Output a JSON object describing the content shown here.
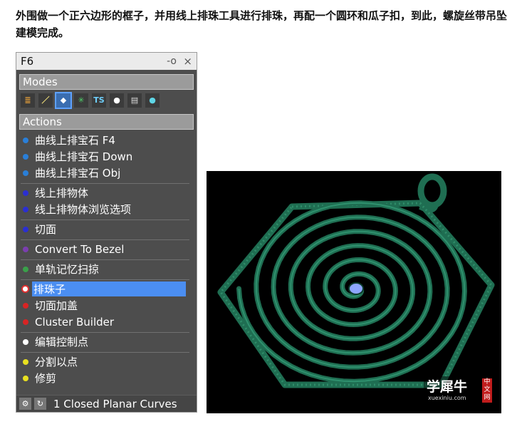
{
  "intro_text": "外围做一个正六边形的框子，并用线上排珠工具进行排珠，再配一个圆环和瓜子扣，到此，螺旋丝带吊坠建模完成。",
  "panel": {
    "title": "F6",
    "pin_icon": "pin-icon",
    "close_glyph": "×",
    "modes_heading": "Modes",
    "mode_icons": [
      {
        "name": "list-icon",
        "glyph": "≣",
        "color": "#e8a23a"
      },
      {
        "name": "curve-icon",
        "glyph": "／",
        "color": "#f5e37a"
      },
      {
        "name": "gem-icon",
        "glyph": "◆",
        "color": "#ffffff"
      },
      {
        "name": "lattice-icon",
        "glyph": "✳",
        "color": "#4fd06b"
      },
      {
        "name": "ts-icon",
        "glyph": "TS",
        "color": "#6fd1ff"
      },
      {
        "name": "user-icon",
        "glyph": "●",
        "color": "#ffffff"
      },
      {
        "name": "document-icon",
        "glyph": "▤",
        "color": "#dddddd"
      },
      {
        "name": "sphere-icon",
        "glyph": "●",
        "color": "#5fd6e6"
      }
    ],
    "actions_heading": "Actions",
    "groups": [
      [
        {
          "label": "曲线上排宝石 F4",
          "dot": "#2a7fd8"
        },
        {
          "label": "曲线上排宝石 Down",
          "dot": "#2a7fd8"
        },
        {
          "label": "曲线上排宝石 Obj",
          "dot": "#2a7fd8"
        }
      ],
      [
        {
          "label": "线上排物体",
          "dot": "#2b2fd1"
        },
        {
          "label": "线上排物体浏览选项",
          "dot": "#2b2fd1"
        }
      ],
      [
        {
          "label": "切面",
          "dot": "#2b2fd1"
        }
      ],
      [
        {
          "label": "Convert To Bezel",
          "dot": "#7a3fb0"
        }
      ],
      [
        {
          "label": "单轨记忆扫掠",
          "dot": "#3aa04a"
        }
      ],
      [
        {
          "label": "排珠子",
          "dot": "#e03030",
          "selected": true
        },
        {
          "label": "切面加盖",
          "dot": "#d82424"
        },
        {
          "label": "Cluster Builder",
          "dot": "#d82424"
        }
      ],
      [
        {
          "label": "编辑控制点",
          "dot": "#ffffff"
        }
      ],
      [
        {
          "label": "分割以点",
          "dot": "#e8e020"
        },
        {
          "label": "修剪",
          "dot": "#e8e020"
        }
      ]
    ],
    "status_icons": [
      "settings-icon",
      "refresh-icon"
    ],
    "status_text": "1 Closed Planar Curves"
  },
  "render": {
    "background": "#000000",
    "metal_color": "#1f6e52",
    "gem_color": "#8ea6ff",
    "watermark": {
      "main": "学犀牛",
      "sub": "xuexiniu.com",
      "badge": "中文网"
    }
  }
}
